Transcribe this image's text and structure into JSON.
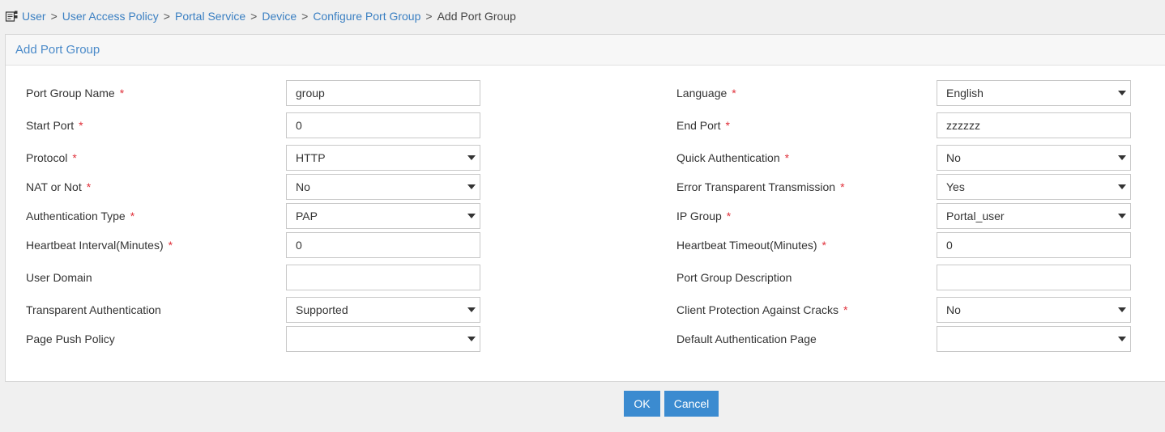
{
  "breadcrumb": {
    "items": [
      "User",
      "User Access Policy",
      "Portal Service",
      "Device",
      "Configure Port Group"
    ],
    "separator": ">",
    "current": "Add Port Group"
  },
  "panel": {
    "title": "Add Port Group"
  },
  "required_mark": "*",
  "form": {
    "left": [
      {
        "label": "Port Group Name",
        "required": true,
        "type": "input",
        "value": "group"
      },
      {
        "label": "Start Port",
        "required": true,
        "type": "input",
        "value": "0"
      },
      {
        "label": "Protocol",
        "required": true,
        "type": "select",
        "value": "HTTP"
      },
      {
        "label": "NAT or Not",
        "required": true,
        "type": "select",
        "value": "No"
      },
      {
        "label": "Authentication Type",
        "required": true,
        "type": "select",
        "value": "PAP"
      },
      {
        "label": "Heartbeat Interval(Minutes)",
        "required": true,
        "type": "input",
        "value": "0"
      },
      {
        "label": "User Domain",
        "required": false,
        "type": "input",
        "value": ""
      },
      {
        "label": "Transparent Authentication",
        "required": false,
        "type": "select",
        "value": "Supported"
      },
      {
        "label": "Page Push Policy",
        "required": false,
        "type": "select",
        "value": ""
      }
    ],
    "right": [
      {
        "label": "Language",
        "required": true,
        "type": "select",
        "value": "English"
      },
      {
        "label": "End Port",
        "required": true,
        "type": "input",
        "value": "zzzzzz"
      },
      {
        "label": "Quick Authentication",
        "required": true,
        "type": "select",
        "value": "No"
      },
      {
        "label": "Error Transparent Transmission",
        "required": true,
        "type": "select",
        "value": "Yes"
      },
      {
        "label": "IP Group",
        "required": true,
        "type": "select",
        "value": "Portal_user"
      },
      {
        "label": "Heartbeat Timeout(Minutes)",
        "required": true,
        "type": "input",
        "value": "0"
      },
      {
        "label": "Port Group Description",
        "required": false,
        "type": "input",
        "value": ""
      },
      {
        "label": "Client Protection Against Cracks",
        "required": true,
        "type": "select",
        "value": "No"
      },
      {
        "label": "Default Authentication Page",
        "required": false,
        "type": "select",
        "value": ""
      }
    ]
  },
  "buttons": {
    "ok": "OK",
    "cancel": "Cancel"
  },
  "colors": {
    "link": "#3a7fc2",
    "required": "#e0303a",
    "button": "#3b8bd0",
    "panel_title": "#4a8ac9"
  },
  "icons": {
    "breadcrumb": "user-config-icon",
    "select": "caret-down-icon"
  }
}
